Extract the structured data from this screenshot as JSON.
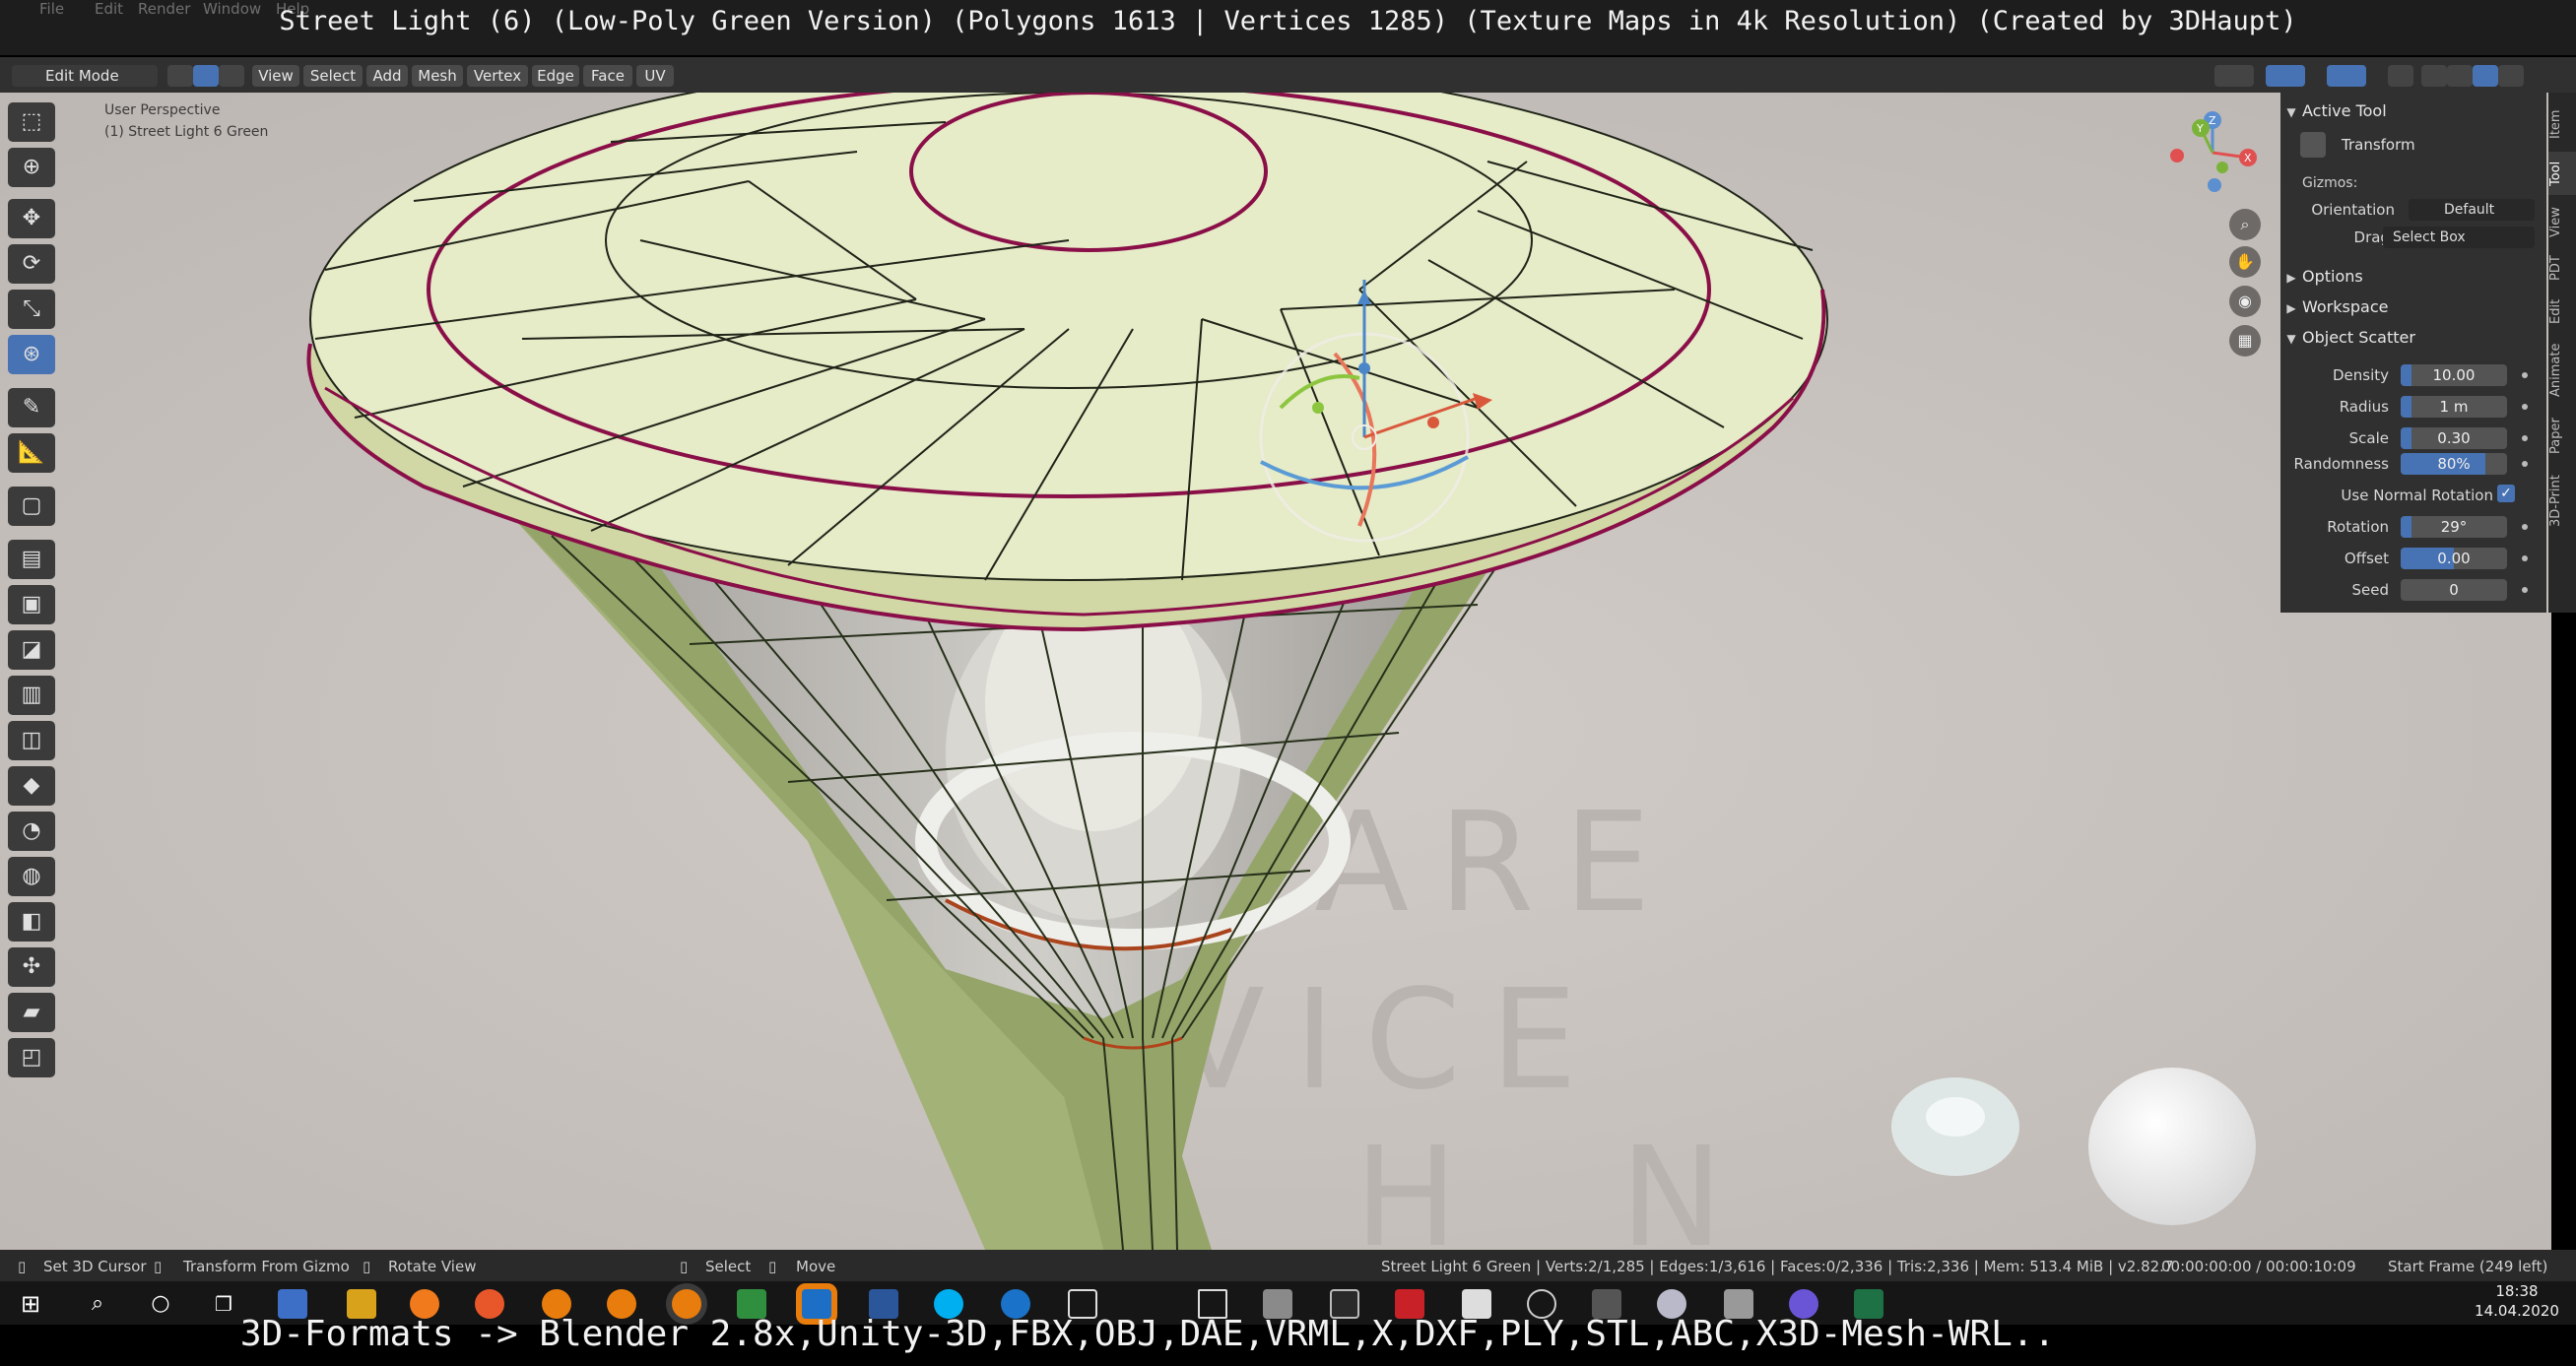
{
  "captions": {
    "title": "Street Light (6) (Low-Poly Green Version) (Polygons 1613 | Vertices 1285) (Texture Maps in 4k Resolution) (Created by 3DHaupt)",
    "bottom": "3D-Formats -> Blender 2.8x,Unity-3D,FBX,OBJ,DAE,VRML,X,DXF,PLY,STL,ABC,X3D-Mesh-WRL.."
  },
  "top_menu_ghost": [
    "File",
    "Edit",
    "Render",
    "Window",
    "Help"
  ],
  "header": {
    "mode": "Edit Mode",
    "menus": [
      "View",
      "Select",
      "Add",
      "Mesh",
      "Vertex",
      "Edge",
      "Face",
      "UV"
    ]
  },
  "viewport": {
    "perspective": "User Perspective",
    "object": "(1) Street Light 6 Green",
    "watermark": [
      "FTWARE",
      "ERVICE",
      "O H N"
    ],
    "axes": [
      "X",
      "Y",
      "Z"
    ]
  },
  "npanel": {
    "tabs": [
      "Item",
      "Tool",
      "View",
      "PDT",
      "Edit",
      "Animate",
      "Paper",
      "3D-Print"
    ],
    "active_tool": {
      "header": "Active Tool",
      "tool": "Transform",
      "gizmos_label": "Gizmos:",
      "orientation_label": "Orientation",
      "orientation_value": "Default",
      "drag_label": "Drag:",
      "drag_value": "Select Box"
    },
    "options_header": "Options",
    "workspace_header": "Workspace",
    "scatter": {
      "header": "Object Scatter",
      "density_label": "Density",
      "density_value": "10.00",
      "density_fill": 0.1,
      "radius_label": "Radius",
      "radius_value": "1 m",
      "radius_fill": 0.1,
      "scale_label": "Scale",
      "scale_value": "0.30",
      "scale_fill": 0.1,
      "randomness_label": "Randomness",
      "randomness_value": "80%",
      "randomness_fill": 0.8,
      "normal_label": "Use Normal Rotation",
      "normal_checked": true,
      "rotation_label": "Rotation",
      "rotation_value": "29°",
      "rotation_fill": 0.1,
      "offset_label": "Offset",
      "offset_value": "0.00",
      "offset_fill": 0.5,
      "seed_label": "Seed",
      "seed_value": "0"
    }
  },
  "status": {
    "cursor": "Set 3D Cursor",
    "gizmo": "Transform From Gizmo",
    "rotate": "Rotate View",
    "select": "Select",
    "move": "Move",
    "stats": "Street Light 6 Green | Verts:2/1,285 | Edges:1/3,616 | Faces:0/2,336 | Tris:2,336 | Mem: 513.4 MiB | v2.82.7",
    "time": "00:00:00:00 / 00:00:10:09",
    "frame": "Start Frame (249 left)"
  },
  "taskbar": {
    "time": "18:38",
    "date": "14.04.2020"
  },
  "colors": {
    "accent": "#4772b3",
    "viewport_bg": "#c7c1bd",
    "mesh_green": "#9aa96b",
    "disc_top": "#e6ebc8",
    "seam": "#8a0f48"
  }
}
